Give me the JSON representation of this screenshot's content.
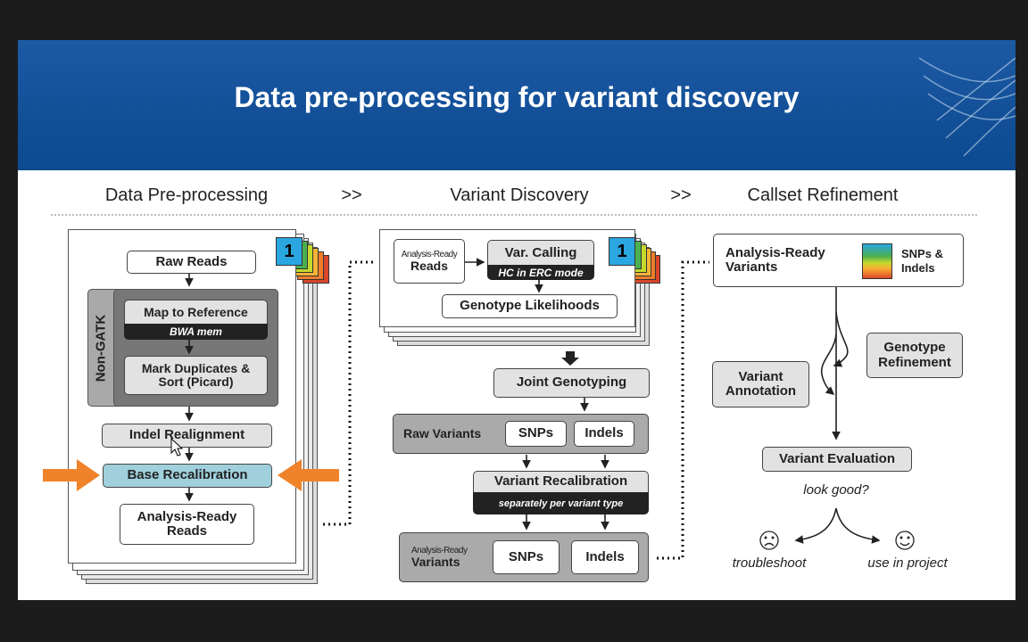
{
  "title": "Data pre-processing for variant discovery",
  "stages": [
    "Data Pre-processing",
    ">>",
    "Variant Discovery",
    ">>",
    "Callset Refinement"
  ],
  "preprocessing": {
    "tab_number": "1",
    "raw_reads": "Raw Reads",
    "non_gatk": "Non-GATK",
    "map_to_reference": "Map to Reference",
    "bwa_mem": "BWA mem",
    "mark_duplicates": "Mark Duplicates & Sort (Picard)",
    "indel_realignment": "Indel Realignment",
    "base_recalibration": "Base Recalibration",
    "analysis_ready_reads": "Analysis-Ready Reads"
  },
  "discovery": {
    "tab_number": "1",
    "analysis_ready": "Analysis-Ready",
    "reads": "Reads",
    "var_calling": "Var. Calling",
    "hc_erc": "HC in ERC mode",
    "genotype_likelihoods": "Genotype Likelihoods",
    "joint_genotyping": "Joint Genotyping",
    "raw_variants": "Raw Variants",
    "snps": "SNPs",
    "indels": "Indels",
    "variant_recalibration": "Variant Recalibration",
    "separately": "separately per variant type",
    "ar_variants_small": "Analysis-Ready",
    "ar_variants": "Variants",
    "snps2": "SNPs",
    "indels2": "Indels"
  },
  "refinement": {
    "analysis_ready_variants": "Analysis-Ready Variants",
    "snps_indels": "SNPs & Indels",
    "genotype_refinement": "Genotype Refinement",
    "variant_annotation": "Variant Annotation",
    "variant_evaluation": "Variant Evaluation",
    "look_good": "look good?",
    "troubleshoot": "troubleshoot",
    "use_in_project": "use in project"
  },
  "colors": {
    "header": "#124f97",
    "highlight": "#9fd0dc",
    "arrow": "#f0832a",
    "tabs": [
      "#2aa7e0",
      "#4caf50",
      "#c5d92d",
      "#f5b335",
      "#ef7d2c",
      "#d9472b"
    ]
  }
}
